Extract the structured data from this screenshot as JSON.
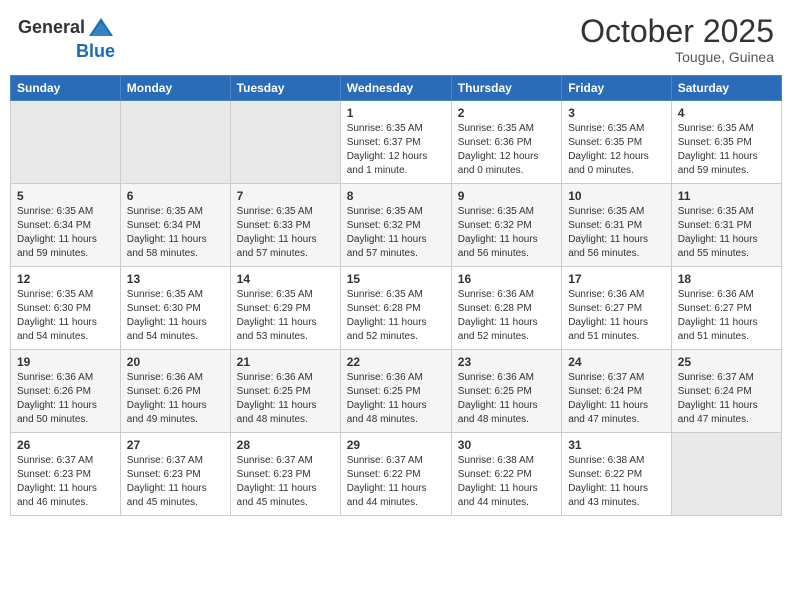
{
  "header": {
    "logo_general": "General",
    "logo_blue": "Blue",
    "month_title": "October 2025",
    "location": "Tougue, Guinea"
  },
  "weekdays": [
    "Sunday",
    "Monday",
    "Tuesday",
    "Wednesday",
    "Thursday",
    "Friday",
    "Saturday"
  ],
  "weeks": [
    [
      {
        "day": "",
        "info": ""
      },
      {
        "day": "",
        "info": ""
      },
      {
        "day": "",
        "info": ""
      },
      {
        "day": "1",
        "info": "Sunrise: 6:35 AM\nSunset: 6:37 PM\nDaylight: 12 hours and 1 minute."
      },
      {
        "day": "2",
        "info": "Sunrise: 6:35 AM\nSunset: 6:36 PM\nDaylight: 12 hours and 0 minutes."
      },
      {
        "day": "3",
        "info": "Sunrise: 6:35 AM\nSunset: 6:35 PM\nDaylight: 12 hours and 0 minutes."
      },
      {
        "day": "4",
        "info": "Sunrise: 6:35 AM\nSunset: 6:35 PM\nDaylight: 11 hours and 59 minutes."
      }
    ],
    [
      {
        "day": "5",
        "info": "Sunrise: 6:35 AM\nSunset: 6:34 PM\nDaylight: 11 hours and 59 minutes."
      },
      {
        "day": "6",
        "info": "Sunrise: 6:35 AM\nSunset: 6:34 PM\nDaylight: 11 hours and 58 minutes."
      },
      {
        "day": "7",
        "info": "Sunrise: 6:35 AM\nSunset: 6:33 PM\nDaylight: 11 hours and 57 minutes."
      },
      {
        "day": "8",
        "info": "Sunrise: 6:35 AM\nSunset: 6:32 PM\nDaylight: 11 hours and 57 minutes."
      },
      {
        "day": "9",
        "info": "Sunrise: 6:35 AM\nSunset: 6:32 PM\nDaylight: 11 hours and 56 minutes."
      },
      {
        "day": "10",
        "info": "Sunrise: 6:35 AM\nSunset: 6:31 PM\nDaylight: 11 hours and 56 minutes."
      },
      {
        "day": "11",
        "info": "Sunrise: 6:35 AM\nSunset: 6:31 PM\nDaylight: 11 hours and 55 minutes."
      }
    ],
    [
      {
        "day": "12",
        "info": "Sunrise: 6:35 AM\nSunset: 6:30 PM\nDaylight: 11 hours and 54 minutes."
      },
      {
        "day": "13",
        "info": "Sunrise: 6:35 AM\nSunset: 6:30 PM\nDaylight: 11 hours and 54 minutes."
      },
      {
        "day": "14",
        "info": "Sunrise: 6:35 AM\nSunset: 6:29 PM\nDaylight: 11 hours and 53 minutes."
      },
      {
        "day": "15",
        "info": "Sunrise: 6:35 AM\nSunset: 6:28 PM\nDaylight: 11 hours and 52 minutes."
      },
      {
        "day": "16",
        "info": "Sunrise: 6:36 AM\nSunset: 6:28 PM\nDaylight: 11 hours and 52 minutes."
      },
      {
        "day": "17",
        "info": "Sunrise: 6:36 AM\nSunset: 6:27 PM\nDaylight: 11 hours and 51 minutes."
      },
      {
        "day": "18",
        "info": "Sunrise: 6:36 AM\nSunset: 6:27 PM\nDaylight: 11 hours and 51 minutes."
      }
    ],
    [
      {
        "day": "19",
        "info": "Sunrise: 6:36 AM\nSunset: 6:26 PM\nDaylight: 11 hours and 50 minutes."
      },
      {
        "day": "20",
        "info": "Sunrise: 6:36 AM\nSunset: 6:26 PM\nDaylight: 11 hours and 49 minutes."
      },
      {
        "day": "21",
        "info": "Sunrise: 6:36 AM\nSunset: 6:25 PM\nDaylight: 11 hours and 48 minutes."
      },
      {
        "day": "22",
        "info": "Sunrise: 6:36 AM\nSunset: 6:25 PM\nDaylight: 11 hours and 48 minutes."
      },
      {
        "day": "23",
        "info": "Sunrise: 6:36 AM\nSunset: 6:25 PM\nDaylight: 11 hours and 48 minutes."
      },
      {
        "day": "24",
        "info": "Sunrise: 6:37 AM\nSunset: 6:24 PM\nDaylight: 11 hours and 47 minutes."
      },
      {
        "day": "25",
        "info": "Sunrise: 6:37 AM\nSunset: 6:24 PM\nDaylight: 11 hours and 47 minutes."
      }
    ],
    [
      {
        "day": "26",
        "info": "Sunrise: 6:37 AM\nSunset: 6:23 PM\nDaylight: 11 hours and 46 minutes."
      },
      {
        "day": "27",
        "info": "Sunrise: 6:37 AM\nSunset: 6:23 PM\nDaylight: 11 hours and 45 minutes."
      },
      {
        "day": "28",
        "info": "Sunrise: 6:37 AM\nSunset: 6:23 PM\nDaylight: 11 hours and 45 minutes."
      },
      {
        "day": "29",
        "info": "Sunrise: 6:37 AM\nSunset: 6:22 PM\nDaylight: 11 hours and 44 minutes."
      },
      {
        "day": "30",
        "info": "Sunrise: 6:38 AM\nSunset: 6:22 PM\nDaylight: 11 hours and 44 minutes."
      },
      {
        "day": "31",
        "info": "Sunrise: 6:38 AM\nSunset: 6:22 PM\nDaylight: 11 hours and 43 minutes."
      },
      {
        "day": "",
        "info": ""
      }
    ]
  ]
}
